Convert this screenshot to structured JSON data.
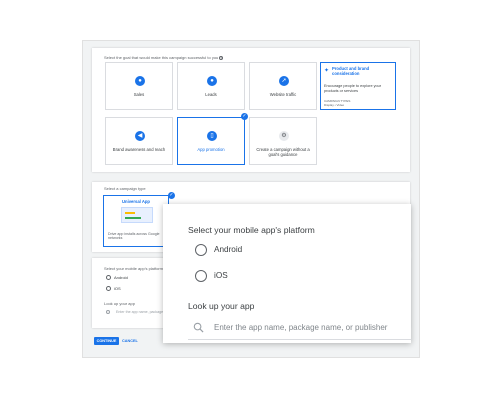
{
  "goal_section": {
    "title": "Select the goal that would make this campaign successful to you",
    "tiles": [
      {
        "label": "Sales",
        "icon": "tag-icon"
      },
      {
        "label": "Leads",
        "icon": "people-icon"
      },
      {
        "label": "Website traffic",
        "icon": "cursor-icon"
      },
      {
        "label": "Brand awareness and reach",
        "icon": "megaphone-icon"
      },
      {
        "label": "App promotion",
        "icon": "phone-icon",
        "selected": true
      },
      {
        "label": "Create a campaign without a goal's guidance",
        "icon": "gear-icon"
      }
    ],
    "featured": {
      "title": "Product and brand consideration",
      "description": "Encourage people to explore your products or services",
      "campaign_types_label": "CAMPAIGN TYPES",
      "campaign_types": "Display • Video"
    }
  },
  "campaign_type": {
    "title": "Select a campaign type",
    "tile_title": "Universal App",
    "tile_description": "Drive app installs across Google networks"
  },
  "platform_small": {
    "title": "Select your mobile app's platform",
    "options": [
      "Android",
      "iOS"
    ],
    "lookup_label": "Look up your app",
    "search_placeholder": "Enter the app name, package name, or publisher"
  },
  "buttons": {
    "continue": "CONTINUE",
    "cancel": "CANCEL"
  },
  "zoom_panel": {
    "title": "Select your mobile app's platform",
    "options": [
      "Android",
      "iOS"
    ],
    "lookup_label": "Look up your app",
    "search_placeholder": "Enter the app name, package name, or publisher"
  },
  "colors": {
    "accent": "#1a73e8",
    "background": "#f1f3f4"
  }
}
